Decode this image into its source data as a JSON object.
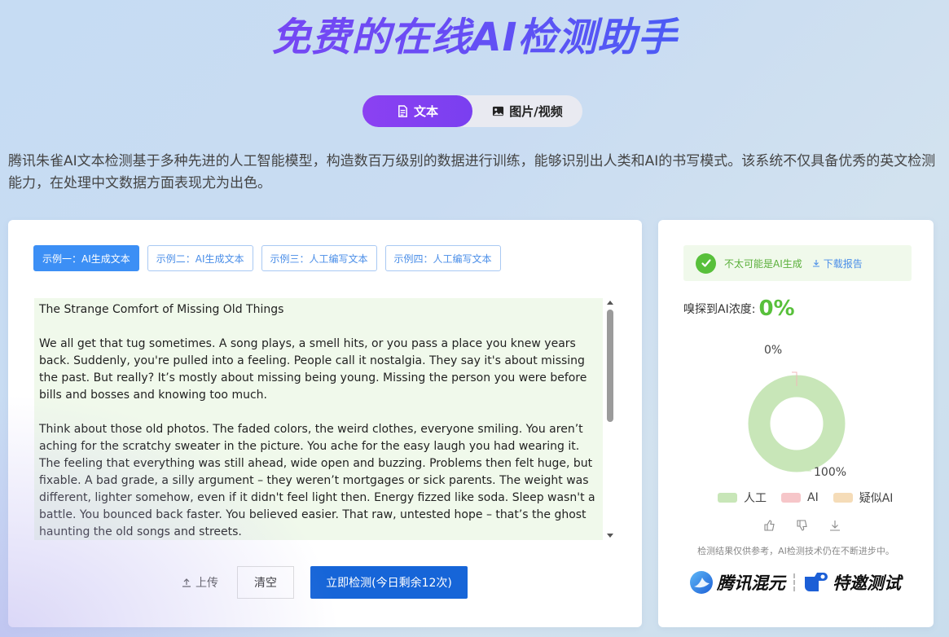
{
  "header": {
    "title": "免费的在线AI检测助手"
  },
  "tabs": [
    {
      "label": "文本",
      "icon": "document-icon",
      "active": true
    },
    {
      "label": "图片/视频",
      "icon": "image-icon",
      "active": false
    }
  ],
  "intro": "腾讯朱雀AI文本检测基于多种先进的人工智能模型，构造数百万级别的数据进行训练，能够识别出人类和AI的书写模式。该系统不仅具备优秀的英文检测能力，在处理中文数据方面表现尤为出色。",
  "examples": [
    {
      "label": "示例一：AI生成文本",
      "active": true
    },
    {
      "label": "示例二：AI生成文本",
      "active": false
    },
    {
      "label": "示例三：人工编写文本",
      "active": false
    },
    {
      "label": "示例四：人工编写文本",
      "active": false
    }
  ],
  "editor": {
    "paragraphs": [
      "The Strange Comfort of Missing Old Things",
      "We all get that tug sometimes. A song plays, a smell hits, or you pass a place you knew years back. Suddenly, you're pulled into a feeling. People call it nostalgia. They say it's about missing the past. But really? It’s mostly about missing being young. Missing the person you were before bills and bosses and knowing too much.",
      "Think about those old photos. The faded colors, the weird clothes, everyone smiling. You aren’t aching for the scratchy sweater in the picture. You ache for the easy laugh you had wearing it. The feeling that everything was still ahead, wide open and buzzing. Problems then felt huge, but fixable. A bad grade, a silly argument – they weren’t mortgages or sick parents. The weight was different, lighter somehow, even if it didn't feel light then. Energy fizzed like soda. Sleep wasn't a battle. You bounced back faster. You believed easier. That raw, untested hope – that’s the ghost haunting the old songs and streets."
    ]
  },
  "actions": {
    "upload_label": "上传",
    "clear_label": "清空",
    "detect_label": "立即检测(今日剩余12次)"
  },
  "result": {
    "status_text": "不太可能是AI生成",
    "download_label": "下载报告",
    "score_label": "嗅探到AI浓度:",
    "score_value": "0%"
  },
  "chart_data": {
    "type": "pie",
    "categories": [
      "人工",
      "AI",
      "疑似AI"
    ],
    "values": [
      100,
      0,
      0
    ],
    "slice_labels": [
      "100%",
      "0%"
    ],
    "colors": [
      "#c8e6b8",
      "#f6c6c9",
      "#f5dcb8"
    ],
    "legend": "bottom"
  },
  "legend": [
    {
      "label": "人工",
      "color": "#c8e6b8"
    },
    {
      "label": "AI",
      "color": "#f6c6c9"
    },
    {
      "label": "疑似AI",
      "color": "#f5dcb8"
    }
  ],
  "disclaimer": "检测结果仅供参考，AI检测技术仍在不断进步中。",
  "brands": {
    "hunyuan": "腾讯混元",
    "special": "特邀测试"
  }
}
